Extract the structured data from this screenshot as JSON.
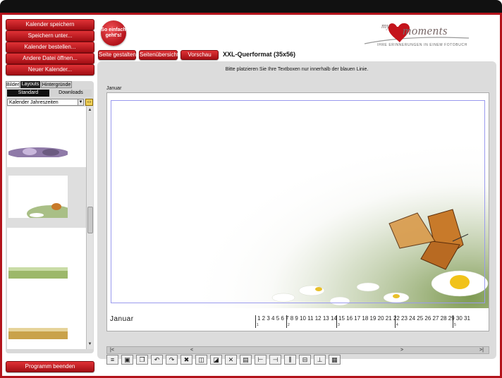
{
  "sidebar_buttons": {
    "save": "Kalender speichern",
    "save_as": "Speichern unter...",
    "order": "Kalender bestellen...",
    "open_other": "Andere Datei öffnen...",
    "new": "Neuer Kalender..."
  },
  "help_badge": "So einfach geht's!",
  "logo": {
    "my": "my",
    "moments": "moments",
    "tagline": "IHRE ERINNERUNGEN IN EINEM FOTOBUCH"
  },
  "top_tabs": {
    "design_page": "Seite gestalten",
    "page_overview": "Seitenübersicht",
    "preview": "Vorschau"
  },
  "format_title": "XXL-Querformat (35x56)",
  "hint": "Bitte platzieren Sie Ihre Textboxen nur innerhalb der blauen Linie.",
  "page_label": "Januar",
  "panel_tabs": [
    "Bilder",
    "Layouts",
    "Hintergründe"
  ],
  "panel_subtabs": [
    "Standard",
    "Downloads"
  ],
  "background_select": "Kalender Jahreszeiten",
  "calendar": {
    "month": "Januar",
    "days": "1 2 3 4 5 6 7 8 9 10 11 12 13 14 15 16 17 18 19 20 21 22 23 24 25 26 27 28 29 30 31",
    "weeks": [
      "1",
      "2",
      "3",
      "4",
      "5"
    ]
  },
  "exit_button": "Programm beenden",
  "colors": {
    "brand_red": "#b3131b",
    "guide_blue": "#9a9aee",
    "panel_gray": "#dcdcdc"
  }
}
